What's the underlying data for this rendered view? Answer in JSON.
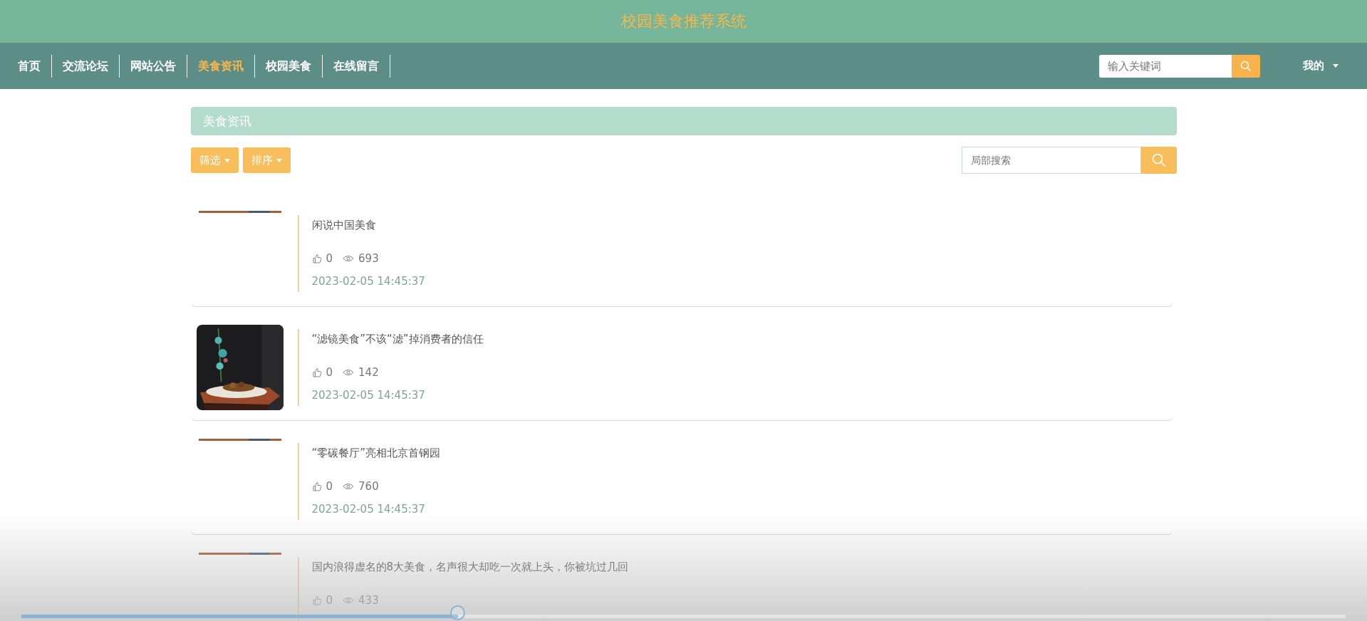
{
  "site_title": "校园美食推荐系统",
  "nav": [
    {
      "label": "首页",
      "selected": false
    },
    {
      "label": "交流论坛",
      "selected": false
    },
    {
      "label": "网站公告",
      "selected": false
    },
    {
      "label": "美食资讯",
      "selected": true
    },
    {
      "label": "校园美食",
      "selected": false
    },
    {
      "label": "在线留言",
      "selected": false
    }
  ],
  "top_search": {
    "placeholder": "输入关键词"
  },
  "user_menu": "我的",
  "section_title": "美食资讯",
  "filters": [
    "筛选",
    "排序"
  ],
  "local_search": {
    "placeholder": "局部搜索"
  },
  "articles": [
    {
      "title": "闲说中国美食",
      "likes": "0",
      "views": "693",
      "date": "2023-02-05 14:45:37",
      "image_loaded": false
    },
    {
      "title": "“滤镜美食”不该“滤”掉消费者的信任",
      "likes": "0",
      "views": "142",
      "date": "2023-02-05 14:45:37",
      "image_loaded": true
    },
    {
      "title": "“零碳餐厅”亮相北京首钢园",
      "likes": "0",
      "views": "760",
      "date": "2023-02-05 14:45:37",
      "image_loaded": false
    },
    {
      "title": "国内浪得虚名的8大美食，名声很大却吃一次就上头，你被坑过几回",
      "likes": "0",
      "views": "433",
      "image_loaded": false
    }
  ],
  "player": {
    "level": 0.33
  }
}
